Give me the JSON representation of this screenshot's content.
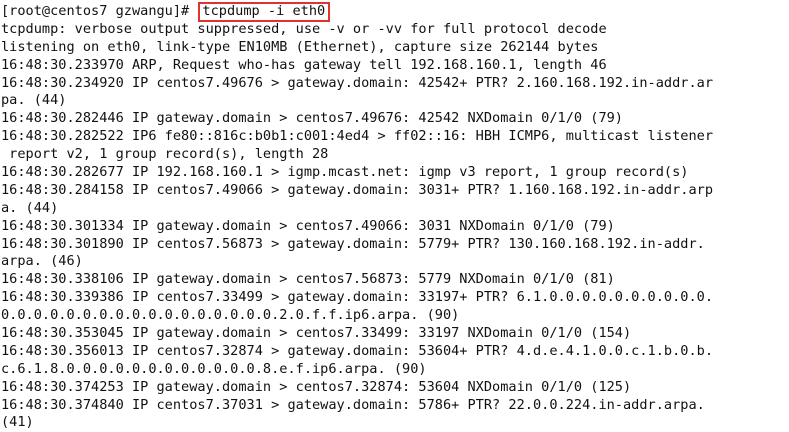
{
  "terminal": {
    "prompt": "[root@centos7 gzwangu]# ",
    "command": "tcpdump -i eth0",
    "lines": [
      "tcpdump: verbose output suppressed, use -v or -vv for full protocol decode",
      "listening on eth0, link-type EN10MB (Ethernet), capture size 262144 bytes",
      "16:48:30.233970 ARP, Request who-has gateway tell 192.168.160.1, length 46",
      "16:48:30.234920 IP centos7.49676 > gateway.domain: 42542+ PTR? 2.160.168.192.in-addr.ar",
      "pa. (44)",
      "16:48:30.282446 IP gateway.domain > centos7.49676: 42542 NXDomain 0/1/0 (79)",
      "16:48:30.282522 IP6 fe80::816c:b0b1:c001:4ed4 > ff02::16: HBH ICMP6, multicast listener",
      " report v2, 1 group record(s), length 28",
      "16:48:30.282677 IP 192.168.160.1 > igmp.mcast.net: igmp v3 report, 1 group record(s)",
      "16:48:30.284158 IP centos7.49066 > gateway.domain: 3031+ PTR? 1.160.168.192.in-addr.arp",
      "a. (44)",
      "16:48:30.301334 IP gateway.domain > centos7.49066: 3031 NXDomain 0/1/0 (79)",
      "16:48:30.301890 IP centos7.56873 > gateway.domain: 5779+ PTR? 130.160.168.192.in-addr.",
      "arpa. (46)",
      "16:48:30.338106 IP gateway.domain > centos7.56873: 5779 NXDomain 0/1/0 (81)",
      "16:48:30.339386 IP centos7.33499 > gateway.domain: 33197+ PTR? 6.1.0.0.0.0.0.0.0.0.0.0.",
      "0.0.0.0.0.0.0.0.0.0.0.0.0.0.0.0.0.2.0.f.f.ip6.arpa. (90)",
      "16:48:30.353045 IP gateway.domain > centos7.33499: 33197 NXDomain 0/1/0 (154)",
      "16:48:30.356013 IP centos7.32874 > gateway.domain: 53604+ PTR? 4.d.e.4.1.0.0.c.1.b.0.b.",
      "c.6.1.8.0.0.0.0.0.0.0.0.0.0.0.0.8.e.f.ip6.arpa. (90)",
      "16:48:30.374253 IP gateway.domain > centos7.32874: 53604 NXDomain 0/1/0 (125)",
      "16:48:30.374840 IP centos7.37031 > gateway.domain: 5786+ PTR? 22.0.0.224.in-addr.arpa.",
      "(41)"
    ]
  },
  "colors": {
    "background": "#ffffff",
    "text": "#111111",
    "highlight_border": "#e0322f"
  }
}
